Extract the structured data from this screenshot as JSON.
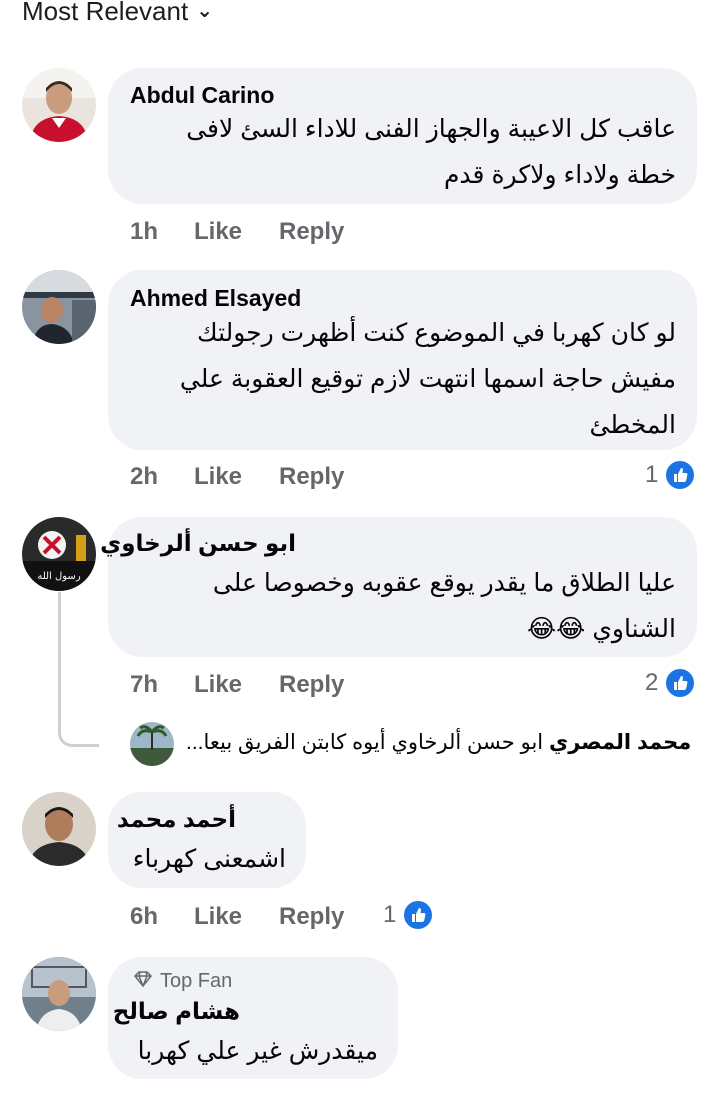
{
  "sort_label": "Most Relevant",
  "actions": {
    "like": "Like",
    "reply": "Reply"
  },
  "comments": [
    {
      "author": "Abdul Carino",
      "text_lines": [
        "عاقب كل الاعيبة والجهاز الفنى للاداء السئ لافى",
        "خطة ولاداء ولاكرة قدم"
      ],
      "time": "1h",
      "likes": ""
    },
    {
      "author": "Ahmed Elsayed",
      "text_lines": [
        "لو كان كهربا في الموضوع كنت أظهرت رجولتك",
        "مفيش حاجة اسمها انتهت لازم توقيع العقوبة علي",
        "المخطئ"
      ],
      "time": "2h",
      "likes": "1"
    },
    {
      "author": "ابو حسن ألرخاوي",
      "text_lines": [
        "عليا الطلاق ما يقدر يوقع عقوبه وخصوصا على",
        "الشناوي"
      ],
      "emoji": "😂😂",
      "time": "7h",
      "likes": "2"
    },
    {
      "author": "أحمد محمد",
      "text_lines": [
        "اشمعنى كهرباء"
      ],
      "time": "6h",
      "likes": "1"
    },
    {
      "author": "هشام صالح",
      "badge": "Top Fan",
      "text_lines": [
        "ميقدرش غير علي كهربا"
      ]
    }
  ],
  "reply_preview": {
    "author": "محمد المصري",
    "text": "ابو حسن ألرخاوي  أيوه كابتن الفريق بيعا..."
  }
}
